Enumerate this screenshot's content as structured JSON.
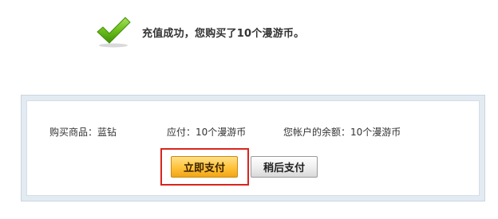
{
  "success": {
    "icon": "checkmark-icon",
    "message": "充值成功，您购买了10个漫游币。"
  },
  "order": {
    "product": "购买商品：蓝钻",
    "price": "应付：10个漫游币",
    "balance": "您帐户的余额：10个漫游币"
  },
  "actions": {
    "pay_now_label": "立即支付",
    "pay_later_label": "稍后支付"
  },
  "colors": {
    "check_green": "#6cbf1c",
    "highlight_red": "#d9251d",
    "pay_button": "#ffc23a",
    "panel_border": "#e3ebf2"
  }
}
